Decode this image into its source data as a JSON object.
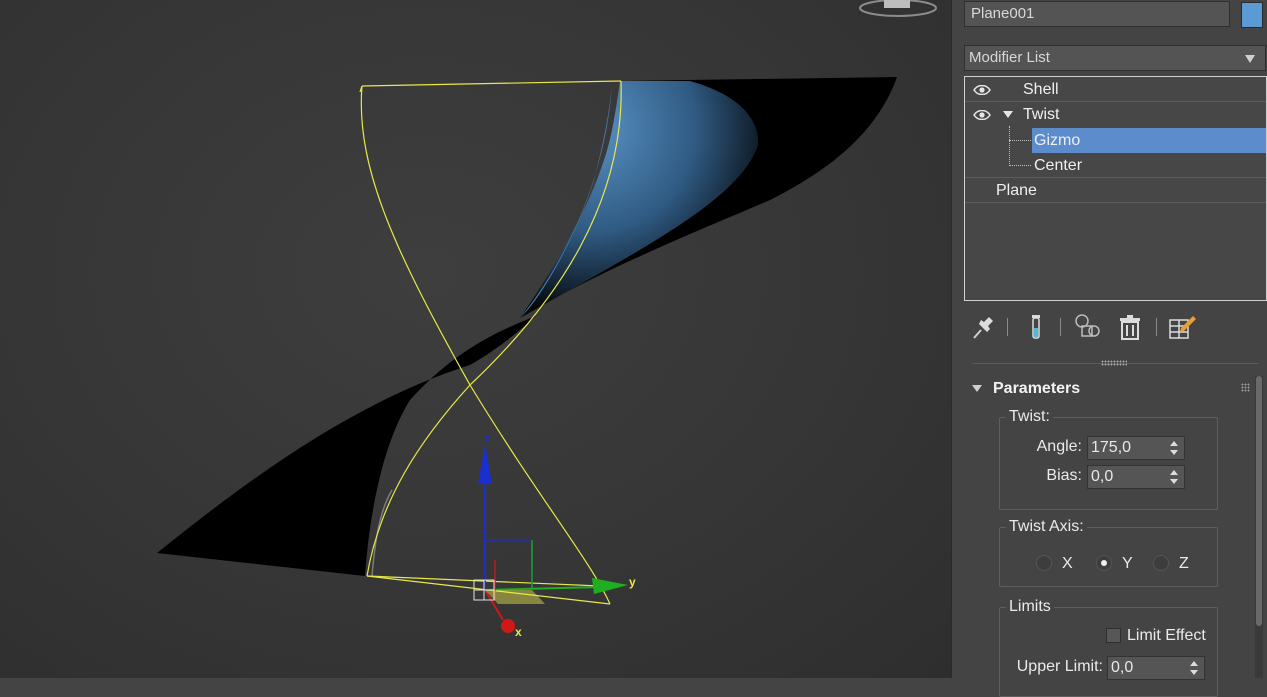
{
  "object_name": "Plane001",
  "object_color": "#5b9bd5",
  "modifier_list_label": "Modifier List",
  "stack": {
    "items": [
      {
        "label": "Shell",
        "visible_icon": "eye-icon"
      },
      {
        "label": "Twist",
        "visible_icon": "eye-icon",
        "expanded": true
      },
      {
        "label": "Gizmo",
        "selected": true
      },
      {
        "label": "Center"
      },
      {
        "label": "Plane"
      }
    ],
    "selected_color": "#5c8ccc"
  },
  "stack_toolbar": [
    "pin-stack-icon",
    "show-end-result-icon",
    "make-unique-icon",
    "remove-modifier-icon",
    "configure-modifier-sets-icon"
  ],
  "rollout": {
    "title": "Parameters",
    "twist_group": {
      "title": "Twist:",
      "angle_label": "Angle:",
      "angle_value": "175,0",
      "bias_label": "Bias:",
      "bias_value": "0,0"
    },
    "axis_group": {
      "title": "Twist Axis:",
      "options": [
        "X",
        "Y",
        "Z"
      ],
      "selected": "Y"
    },
    "limits_group": {
      "title": "Limits",
      "limit_effect_label": "Limit Effect",
      "limit_effect_checked": false,
      "upper_limit_label": "Upper Limit:",
      "upper_limit_value": "0,0"
    }
  },
  "viewport": {
    "gizmo_axes": {
      "x": "x",
      "y": "y",
      "z": "z"
    },
    "axis_colors": {
      "x": "#d01818",
      "y": "#1fae1f",
      "z": "#1a2fd0"
    },
    "gizmo_color": "#e8e84a",
    "surface_highlight": "#4e86b8"
  }
}
